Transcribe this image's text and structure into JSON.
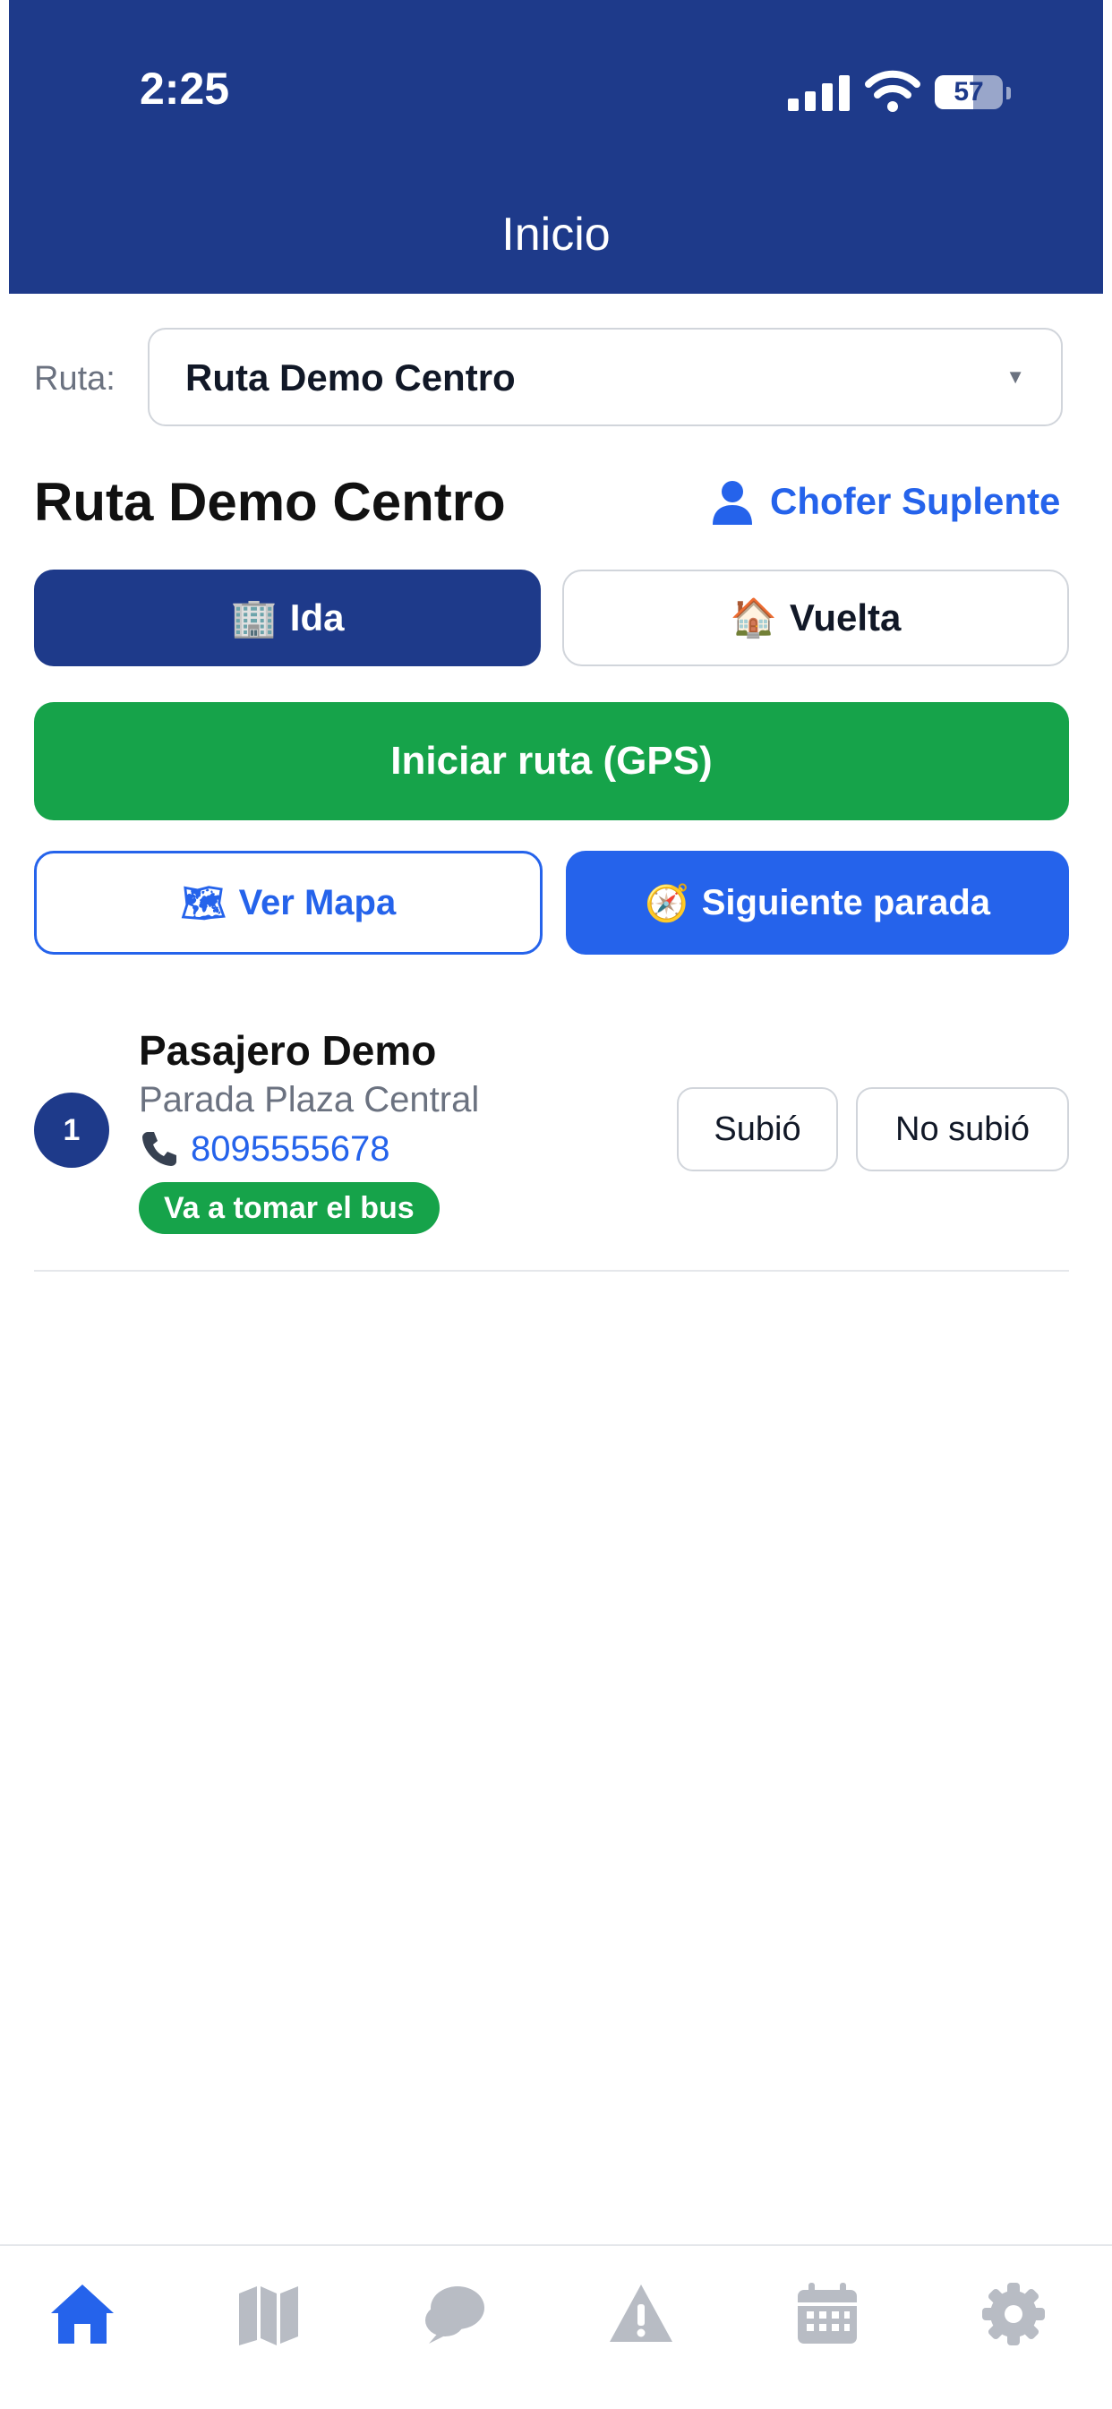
{
  "status_bar": {
    "time": "2:25",
    "battery": "57",
    "battery_level": 0.57,
    "icons": [
      "cellular-signal-icon",
      "wifi-icon",
      "battery-icon"
    ]
  },
  "header": {
    "title": "Inicio"
  },
  "route_selector": {
    "label": "Ruta:",
    "selected": "Ruta Demo Centro"
  },
  "route": {
    "name": "Ruta Demo Centro",
    "substitute_driver_label": "Chofer Suplente",
    "direction_buttons": [
      {
        "label": "Ida",
        "icon": "🏢",
        "active": true
      },
      {
        "label": "Vuelta",
        "icon": "🏠",
        "active": false
      }
    ],
    "start_gps_label": "Iniciar ruta (GPS)",
    "view_map_label": "Ver Mapa",
    "view_map_icon": "🗺",
    "next_stop_label": "Siguiente parada",
    "next_stop_icon": "🧭"
  },
  "passengers": [
    {
      "number": "1",
      "name": "Pasajero Demo",
      "stop": "Parada Plaza Central",
      "phone": "8095555678",
      "status": "Va a tomar el bus",
      "boarded_label": "Subió",
      "not_boarded_label": "No subió"
    }
  ],
  "tab_bar": {
    "items": [
      "home-icon",
      "map-icon",
      "chat-icon",
      "alert-icon",
      "calendar-icon",
      "settings-icon"
    ],
    "active_index": 0
  },
  "colors": {
    "primary_dark": "#1e3a8a",
    "primary": "#2563eb",
    "success": "#16a34a",
    "muted": "#6b7280",
    "inactive_tab": "#b8bcc4"
  }
}
